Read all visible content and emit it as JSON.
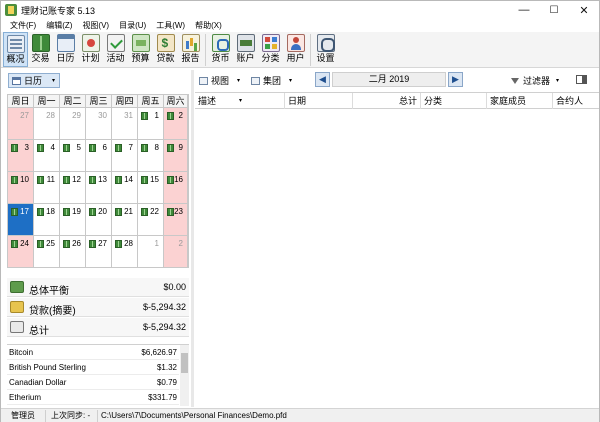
{
  "window": {
    "title": "理财记账专家 5.13",
    "controls": {
      "minimize": "—",
      "maximize": "☐",
      "close": "✕"
    }
  },
  "menu": [
    "文件(F)",
    "编辑(Z)",
    "视图(V)",
    "目录(U)",
    "工具(W)",
    "帮助(X)"
  ],
  "ribbon": [
    {
      "label": "概况",
      "icon": "overview-icon",
      "selected": true
    },
    {
      "label": "交易",
      "icon": "transactions-icon"
    },
    {
      "label": "日历",
      "icon": "calendar-icon"
    },
    {
      "label": "计划",
      "icon": "plan-icon"
    },
    {
      "label": "活动",
      "icon": "activity-icon"
    },
    {
      "label": "预算",
      "icon": "budget-icon"
    },
    {
      "label": "贷款",
      "icon": "loan-icon"
    },
    {
      "label": "报告",
      "icon": "report-icon"
    },
    {
      "label": "货币",
      "icon": "currency-icon"
    },
    {
      "label": "账户",
      "icon": "account-icon"
    },
    {
      "label": "分类",
      "icon": "category-icon"
    },
    {
      "label": "用户",
      "icon": "users-icon"
    },
    {
      "label": "设置",
      "icon": "settings-icon"
    }
  ],
  "left_toolbar": {
    "calendar_button": "日历",
    "dropdown": "▾"
  },
  "calendar": {
    "weekdays": [
      "周日",
      "周一",
      "周二",
      "周三",
      "周四",
      "周五",
      "周六"
    ],
    "weeks": [
      [
        {
          "d": "27",
          "o": true
        },
        {
          "d": "28",
          "o": true
        },
        {
          "d": "29",
          "o": true
        },
        {
          "d": "30",
          "o": true
        },
        {
          "d": "31",
          "o": true
        },
        {
          "d": "1",
          "b": true
        },
        {
          "d": "2",
          "b": true
        }
      ],
      [
        {
          "d": "3",
          "b": true
        },
        {
          "d": "4",
          "b": true
        },
        {
          "d": "5",
          "b": true
        },
        {
          "d": "6",
          "b": true
        },
        {
          "d": "7",
          "b": true
        },
        {
          "d": "8",
          "b": true
        },
        {
          "d": "9",
          "b": true
        }
      ],
      [
        {
          "d": "10",
          "b": true
        },
        {
          "d": "11",
          "b": true
        },
        {
          "d": "12",
          "b": true
        },
        {
          "d": "13",
          "b": true
        },
        {
          "d": "14",
          "b": true
        },
        {
          "d": "15",
          "b": true
        },
        {
          "d": "16",
          "b": true
        }
      ],
      [
        {
          "d": "17",
          "b": true,
          "t": true
        },
        {
          "d": "18",
          "b": true
        },
        {
          "d": "19",
          "b": true
        },
        {
          "d": "20",
          "b": true
        },
        {
          "d": "21",
          "b": true
        },
        {
          "d": "22",
          "b": true
        },
        {
          "d": "23",
          "b": true
        }
      ],
      [
        {
          "d": "24",
          "b": true
        },
        {
          "d": "25",
          "b": true
        },
        {
          "d": "26",
          "b": true
        },
        {
          "d": "27",
          "b": true
        },
        {
          "d": "28",
          "b": true
        },
        {
          "d": "1",
          "o": true
        },
        {
          "d": "2",
          "o": true
        }
      ]
    ]
  },
  "summary": [
    {
      "label": "总体平衡",
      "value": "$0.00",
      "icon": "balance-icon"
    },
    {
      "label": "贷款(摘要)",
      "value": "$-5,294.32",
      "icon": "loan-summary-icon"
    },
    {
      "label": "总计",
      "value": "$-5,294.32",
      "icon": "scale-icon"
    }
  ],
  "currencies": [
    {
      "name": "Bitcoin",
      "value": "$6,626.97"
    },
    {
      "name": "British Pound Sterling",
      "value": "$1.32"
    },
    {
      "name": "Canadian Dollar",
      "value": "$0.79"
    },
    {
      "name": "Etherium",
      "value": "$331.79"
    }
  ],
  "right_toolbar": {
    "view": "视图",
    "group": "集团",
    "month": "二月 2019",
    "prev": "◀",
    "next": "▶",
    "filter": "过滤器",
    "dropdown": "▾"
  },
  "columns": [
    "描述",
    "日期",
    "总计",
    "分类",
    "家庭成员",
    "合约人"
  ],
  "status": {
    "user": "管理员",
    "sync": "上次同步: -",
    "path": "C:\\Users\\7\\Documents\\Personal Finances\\Demo.pfd"
  },
  "colors": {
    "selected_day": "#1e6fc5",
    "weekend": "#fbd2d2",
    "toolbar_selected": "#cfe3f7"
  }
}
